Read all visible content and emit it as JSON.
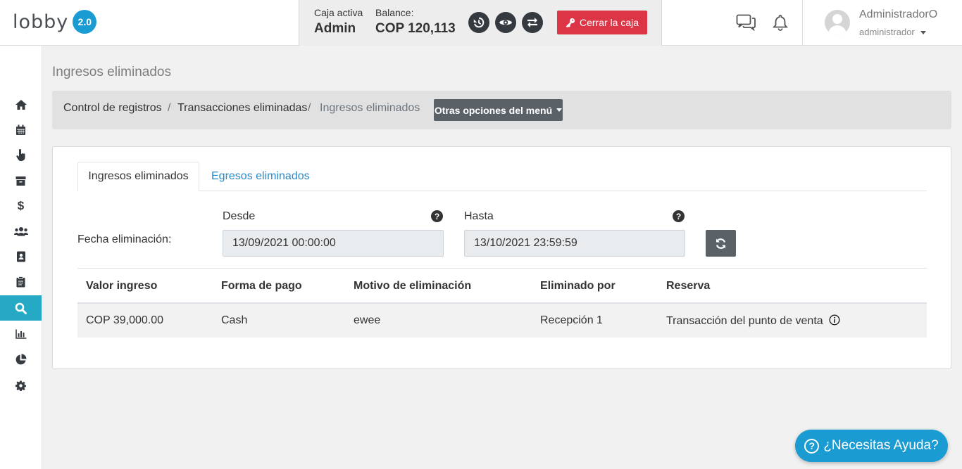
{
  "header": {
    "logo_text": "lobby",
    "logo_version": "2.0",
    "cash_box_label": "Caja activa",
    "cash_box_value": "Admin",
    "balance_label": "Balance:",
    "balance_value": "COP 120,113",
    "close_cash_label": "Cerrar la caja",
    "user_name": "AdministradorO",
    "user_role": "administrador"
  },
  "sidebar": {
    "items": [
      {
        "icon": "home-icon"
      },
      {
        "icon": "calendar-icon"
      },
      {
        "icon": "hand-pointer-icon"
      },
      {
        "icon": "archive-icon"
      },
      {
        "icon": "dollar-icon"
      },
      {
        "icon": "users-icon"
      },
      {
        "icon": "address-book-icon"
      },
      {
        "icon": "clipboard-icon"
      },
      {
        "icon": "search-icon",
        "active": true
      },
      {
        "icon": "bar-chart-icon"
      },
      {
        "icon": "pie-chart-icon"
      },
      {
        "icon": "gear-icon"
      }
    ],
    "active_color": "#26a9c4"
  },
  "page": {
    "title": "Ingresos eliminados",
    "breadcrumb": [
      "Control de registros",
      "Transacciones eliminadas",
      "Ingresos eliminados"
    ],
    "breadcrumb_separator": "/",
    "menu_button": "Otras opciones del menú"
  },
  "tabs": {
    "active": "Ingresos eliminados",
    "other": "Egresos eliminados"
  },
  "filter": {
    "label": "Fecha eliminación:",
    "from_label": "Desde",
    "to_label": "Hasta",
    "from_value": "13/09/2021 00:00:00",
    "to_value": "13/10/2021 23:59:59"
  },
  "table": {
    "headers": [
      "Valor ingreso",
      "Forma de pago",
      "Motivo de eliminación",
      "Eliminado por",
      "Reserva"
    ],
    "rows": [
      [
        "COP 39,000.00",
        "Cash",
        "ewee",
        "Recepción 1",
        "Transacción del punto de venta"
      ]
    ]
  },
  "help": {
    "label": "¿Necesitas Ayuda?"
  },
  "colors": {
    "brand": "#1a9bd1",
    "danger": "#dc3545",
    "secondary": "#5a6268",
    "link": "#2b8ac6"
  }
}
